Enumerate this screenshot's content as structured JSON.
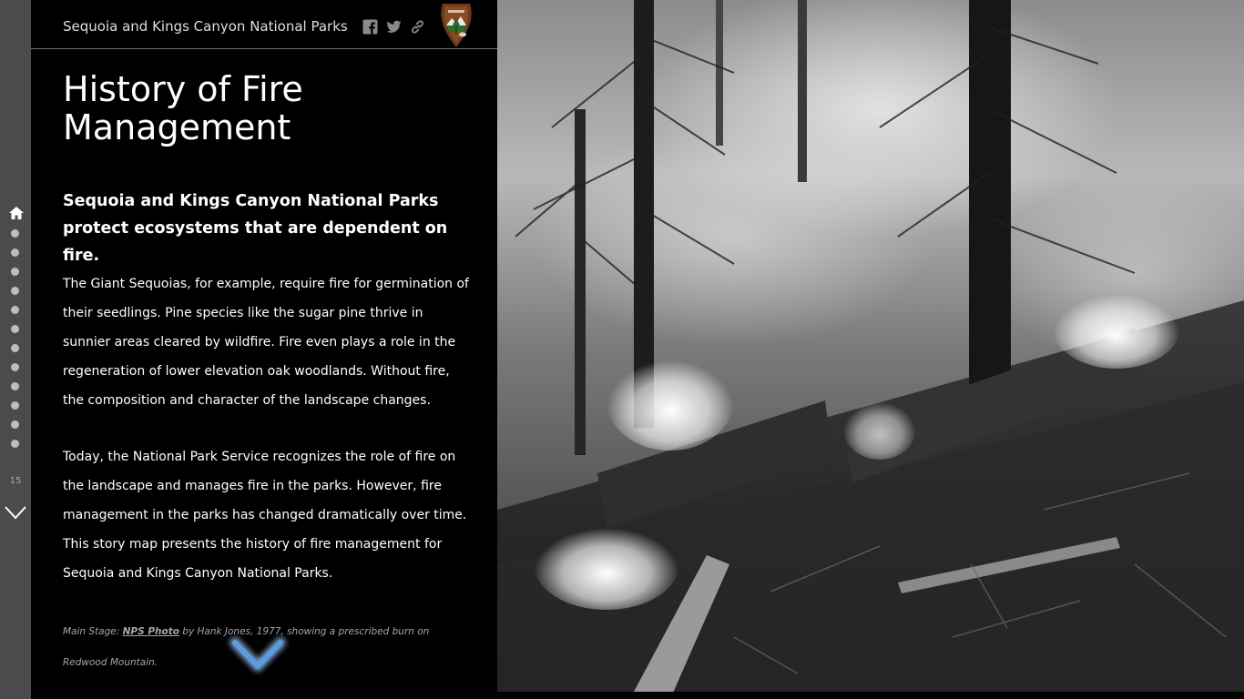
{
  "header": {
    "title": "Sequoia and Kings Canyon National Parks",
    "share_icons": [
      "facebook-icon",
      "twitter-icon",
      "link-icon"
    ],
    "logo": "nps-arrowhead-logo"
  },
  "nav": {
    "home_icon": "home-icon",
    "dot_count": 12,
    "total_label": "15",
    "down_icon": "chevron-down-icon"
  },
  "content": {
    "title": "History of Fire Management",
    "lead": "Sequoia and Kings Canyon National Parks protect ecosystems that are dependent on fire.",
    "paragraph1": "The Giant Sequoias, for example, require fire for germination of their seedlings. Pine species like the sugar pine thrive in sunnier areas cleared by wildfire. Fire even plays a role in the regeneration of lower elevation oak woodlands. Without fire, the composition and character of the landscape changes.",
    "paragraph2": "Today, the National Park Service recognizes the role of fire on the landscape and manages fire in the parks. However, fire management in the parks has changed dramatically over time. This story map presents the history of fire management for Sequoia and Kings Canyon National Parks.",
    "caption": {
      "prefix": "Main Stage: ",
      "link": "NPS Photo",
      "suffix": " by Hank Jones, 1977, showing a prescribed burn on Redwood Mountain."
    }
  },
  "stage": {
    "image": "black-and-white photo of a prescribed burn in a forest"
  },
  "colors": {
    "panel_bg": "#000000",
    "nav_rail": "#4b4b4b",
    "nav_dot": "#bdbdbd",
    "chevron_accent": "#5b9be0"
  }
}
